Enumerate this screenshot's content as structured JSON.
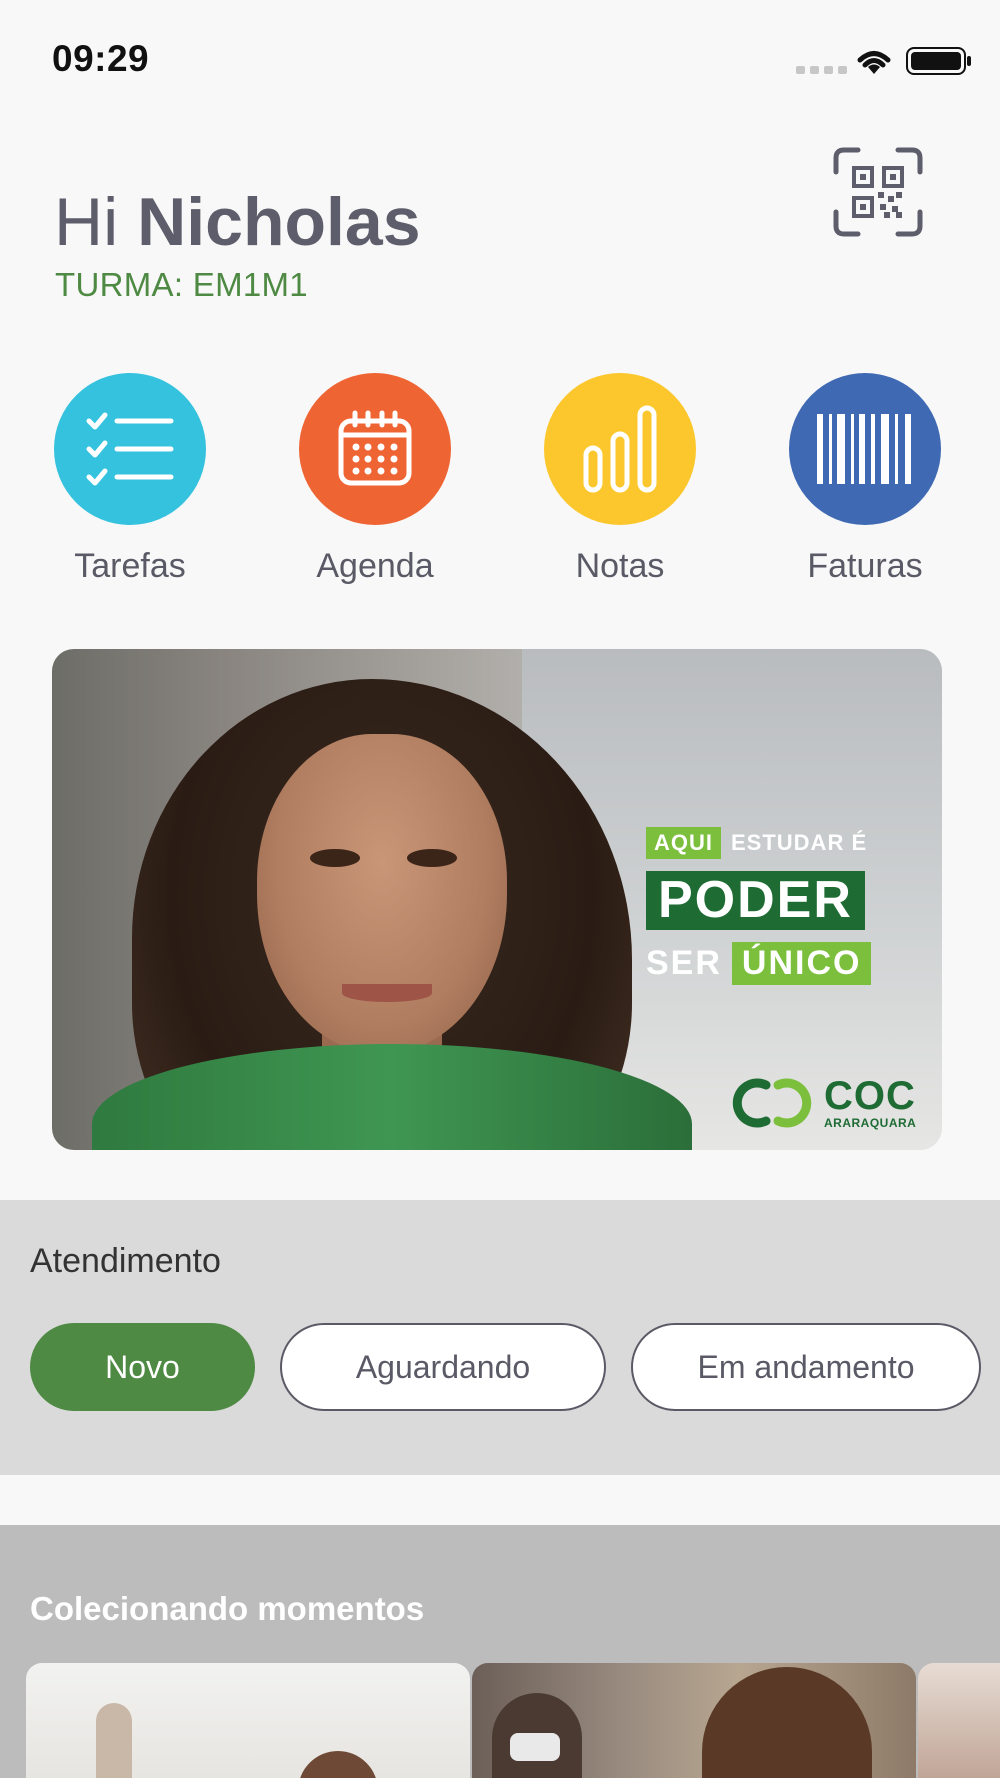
{
  "status_bar": {
    "time": "09:29"
  },
  "header": {
    "greeting_prefix": "Hi",
    "user_name": "Nicholas",
    "turma": "TURMA: EM1M1"
  },
  "shortcuts": [
    {
      "label": "Tarefas",
      "color": "#35c2df",
      "icon": "checklist-icon"
    },
    {
      "label": "Agenda",
      "color": "#ef6433",
      "icon": "calendar-icon"
    },
    {
      "label": "Notas",
      "color": "#fcc72c",
      "icon": "bar-chart-icon"
    },
    {
      "label": "Faturas",
      "color": "#3f69b3",
      "icon": "barcode-icon"
    }
  ],
  "banner": {
    "line1_highlight": "AQUI",
    "line1_rest": "ESTUDAR É",
    "line2": "PODER",
    "line3_prefix": "SER",
    "line3_highlight": "ÚNICO",
    "brand": "COC",
    "brand_city": "ARARAQUARA"
  },
  "atendimento": {
    "title": "Atendimento",
    "filters": [
      {
        "label": "Novo",
        "active": true
      },
      {
        "label": "Aguardando",
        "active": false
      },
      {
        "label": "Em andamento",
        "active": false
      }
    ]
  },
  "moments": {
    "title": "Colecionando momentos"
  },
  "colors": {
    "accent_green": "#4e8a43",
    "text_gray": "#5d5d6b",
    "banner_green": "#1e6b34",
    "lime": "#7bbf3c"
  }
}
